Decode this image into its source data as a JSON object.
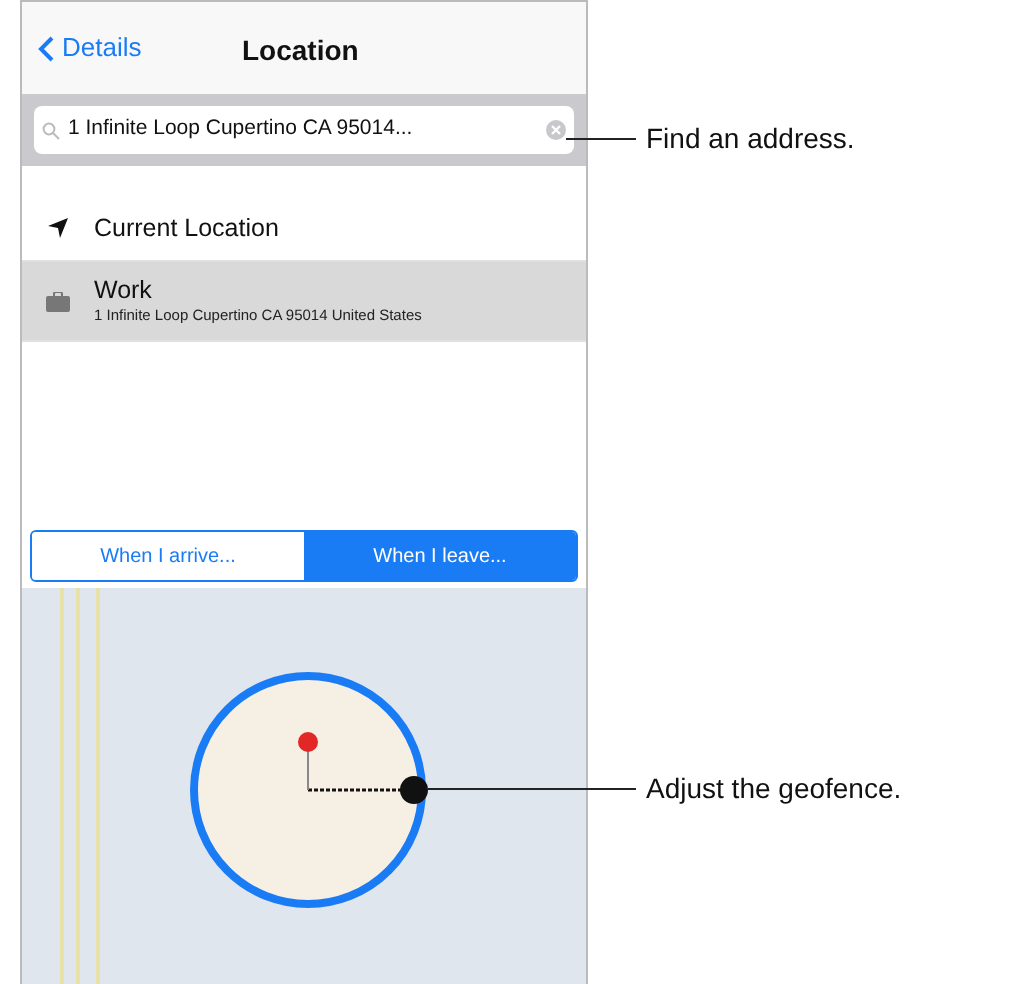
{
  "nav": {
    "back": "Details",
    "title": "Location"
  },
  "search": {
    "value": "1 Infinite Loop Cupertino CA 95014..."
  },
  "locations": [
    {
      "kind": "current",
      "title": "Current Location",
      "selected": false
    },
    {
      "kind": "saved",
      "title": "Work",
      "subtitle": "1 Infinite Loop Cupertino CA 95014 United States",
      "selected": true
    }
  ],
  "trigger": [
    {
      "label": "When I arrive...",
      "selected": false
    },
    {
      "label": "When I leave...",
      "selected": true
    }
  ],
  "callouts": [
    "Find an address.",
    "Adjust the geofence."
  ]
}
